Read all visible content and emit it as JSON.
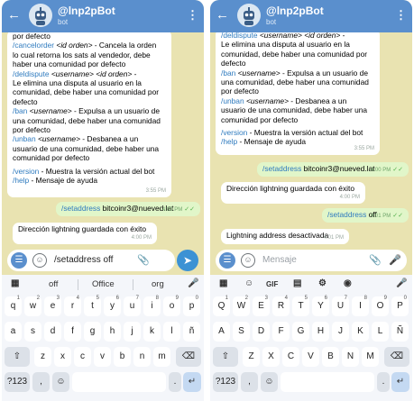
{
  "bot": {
    "title": "@lnp2pBot",
    "subtitle": "bot",
    "back": "←",
    "menu": "⋮"
  },
  "left": {
    "help_bubble": {
      "l1": "por defecto",
      "l2_cmd": "/cancelorder",
      "l2_arg": "<id orden>",
      "l2_rest": " - Cancela la orden",
      "l3": "lo cual retorna los sats al vendedor, debe",
      "l4": "haber una comunidad por defecto",
      "l5_cmd": "/deldispute",
      "l5_arg1": "<username>",
      "l5_arg2": "<id orden>",
      "l6": "Le elimina una disputa al usuario en la",
      "l7": "comunidad, debe haber una comunidad por",
      "l8": "defecto",
      "l9_cmd": "/ban",
      "l9_arg": "<username>",
      "l9_rest": " - Expulsa a un usuario de",
      "l10": "una comunidad, debe haber una comunidad",
      "l11": "por defecto",
      "l12_cmd": "/unban",
      "l12_arg": "<username>",
      "l12_rest": " - Desbanea a un",
      "l13": "usuario de una comunidad, debe haber una",
      "l14": "comunidad por defecto",
      "l15_cmd": "/version",
      "l15_rest": " - Muestra la versión actual del bot",
      "l16_cmd": "/help",
      "l16_rest": " - Mensaje de ayuda",
      "time": "3:55 PM"
    },
    "out_msg": {
      "cmd": "/setaddress",
      "text": " bitcoinr3@nueved.lat",
      "time": "4:00 PM"
    },
    "in_msg": {
      "text": "Dirección lightning guardada con éxito",
      "time": "4:00 PM"
    },
    "input": {
      "value": "/setaddress off"
    },
    "suggestions": [
      "off",
      "Office",
      "org"
    ],
    "rows": [
      [
        {
          "k": "q",
          "h": "1"
        },
        {
          "k": "w",
          "h": "2"
        },
        {
          "k": "e",
          "h": "3"
        },
        {
          "k": "r",
          "h": "4"
        },
        {
          "k": "t",
          "h": "5"
        },
        {
          "k": "y",
          "h": "6"
        },
        {
          "k": "u",
          "h": "7"
        },
        {
          "k": "i",
          "h": "8"
        },
        {
          "k": "o",
          "h": "9"
        },
        {
          "k": "p",
          "h": "0"
        }
      ],
      [
        {
          "k": "a"
        },
        {
          "k": "s"
        },
        {
          "k": "d"
        },
        {
          "k": "f"
        },
        {
          "k": "g"
        },
        {
          "k": "h"
        },
        {
          "k": "j"
        },
        {
          "k": "k"
        },
        {
          "k": "l"
        },
        {
          "k": "ñ"
        }
      ],
      [
        {
          "k": "z"
        },
        {
          "k": "x"
        },
        {
          "k": "c"
        },
        {
          "k": "v"
        },
        {
          "k": "b"
        },
        {
          "k": "n"
        },
        {
          "k": "m"
        }
      ],
      [
        "?123",
        ",",
        ".",
        "↵"
      ]
    ]
  },
  "right": {
    "help_bubble": {
      "l1_cmd": "/deldispute",
      "l1_arg1": "<username>",
      "l1_arg2": "<id orden>",
      "l2": "Le elimina una disputa al usuario en la",
      "l3": "comunidad, debe haber una comunidad por",
      "l4": "defecto",
      "l5_cmd": "/ban",
      "l5_arg": "<username>",
      "l5_rest": " - Expulsa a un usuario de",
      "l6": "una comunidad, debe haber una comunidad",
      "l7": "por defecto",
      "l8_cmd": "/unban",
      "l8_arg": "<username>",
      "l8_rest": " - Desbanea a un",
      "l9": "usuario de una comunidad, debe haber una",
      "l10": "comunidad por defecto",
      "l11_cmd": "/version",
      "l11_rest": " - Muestra la versión actual del bot",
      "l12_cmd": "/help",
      "l12_rest": " - Mensaje de ayuda",
      "time": "3:55 PM"
    },
    "out_msg1": {
      "cmd": "/setaddress",
      "text": " bitcoinr3@nueved.lat",
      "time": "4:00 PM"
    },
    "in_msg1": {
      "text": "Dirección lightning guardada con éxito",
      "time": "4:00 PM"
    },
    "out_msg2": {
      "cmd": "/setaddress",
      "text": " off",
      "time": "4:01 PM"
    },
    "in_msg2": {
      "text": "Lightning address desactivada",
      "time": "4:01 PM"
    },
    "input": {
      "placeholder": "Mensaje"
    },
    "toolbar": [
      "GIF"
    ],
    "rows": [
      [
        {
          "k": "Q",
          "h": "1"
        },
        {
          "k": "W",
          "h": "2"
        },
        {
          "k": "E",
          "h": "3"
        },
        {
          "k": "R",
          "h": "4"
        },
        {
          "k": "T",
          "h": "5"
        },
        {
          "k": "Y",
          "h": "6"
        },
        {
          "k": "U",
          "h": "7"
        },
        {
          "k": "I",
          "h": "8"
        },
        {
          "k": "O",
          "h": "9"
        },
        {
          "k": "P",
          "h": "0"
        }
      ],
      [
        {
          "k": "A"
        },
        {
          "k": "S"
        },
        {
          "k": "D"
        },
        {
          "k": "F"
        },
        {
          "k": "G"
        },
        {
          "k": "H"
        },
        {
          "k": "J"
        },
        {
          "k": "K"
        },
        {
          "k": "L"
        },
        {
          "k": "Ñ"
        }
      ],
      [
        {
          "k": "Z"
        },
        {
          "k": "X"
        },
        {
          "k": "C"
        },
        {
          "k": "V"
        },
        {
          "k": "B"
        },
        {
          "k": "N"
        },
        {
          "k": "M"
        }
      ],
      [
        "?123",
        ",",
        ".",
        "↵"
      ]
    ]
  },
  "colors": {
    "header": "#5a8fcd",
    "chat_bg": "#e9e3b1",
    "bubble_out": "#e1f6c9",
    "link": "#2f7bbf"
  }
}
